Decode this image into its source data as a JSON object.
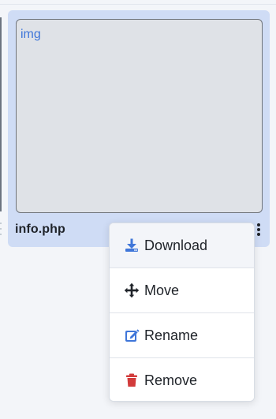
{
  "file_card": {
    "thumbnail_text": "img",
    "file_name": "info.php"
  },
  "menu": {
    "items": [
      {
        "label": "Download",
        "icon": "download-icon",
        "color": "#3f76d9"
      },
      {
        "label": "Move",
        "icon": "move-icon",
        "color": "#1f2329"
      },
      {
        "label": "Rename",
        "icon": "edit-icon",
        "color": "#3f76d9"
      },
      {
        "label": "Remove",
        "icon": "trash-icon",
        "color": "#d23b3b"
      }
    ]
  },
  "colors": {
    "card_background": "#cfdcf5",
    "thumbnail_background": "#dfe2e7",
    "accent": "#3f76d9",
    "danger": "#d23b3b",
    "text": "#1f2329"
  }
}
